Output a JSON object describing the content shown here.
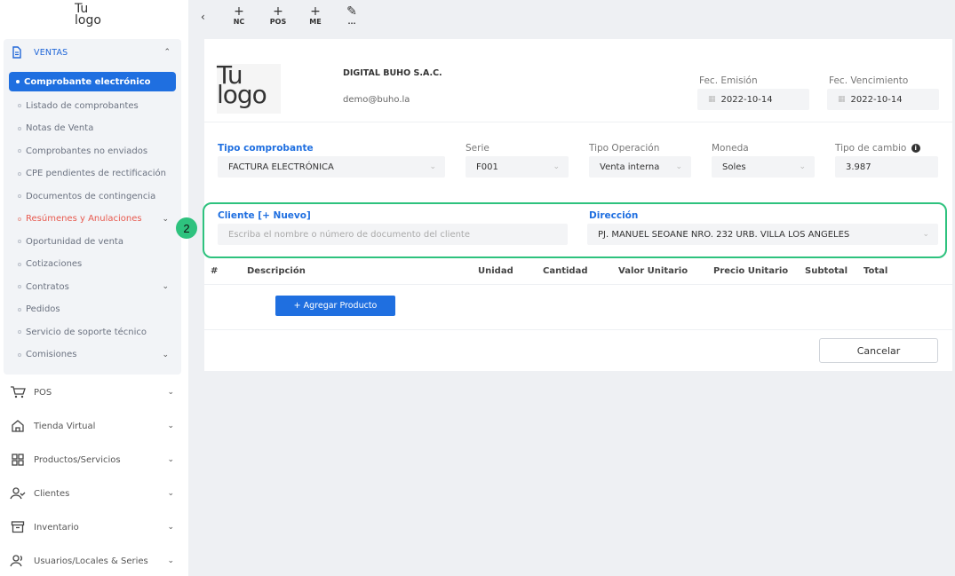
{
  "sidebar": {
    "logo": {
      "line1": "Tu",
      "line2": "logo"
    },
    "ventas": {
      "label": "VENTAS",
      "items": [
        {
          "label": "Comprobante electrónico",
          "active": true
        },
        {
          "label": "Listado de comprobantes"
        },
        {
          "label": "Notas de Venta"
        },
        {
          "label": "Comprobantes no enviados"
        },
        {
          "label": "CPE pendientes de rectificación"
        },
        {
          "label": "Documentos de contingencia"
        },
        {
          "label": "Resúmenes y Anulaciones",
          "highlight": true,
          "expandable": true
        },
        {
          "label": "Oportunidad de venta"
        },
        {
          "label": "Cotizaciones"
        },
        {
          "label": "Contratos",
          "expandable": true
        },
        {
          "label": "Pedidos"
        },
        {
          "label": "Servicio de soporte técnico"
        },
        {
          "label": "Comisiones",
          "expandable": true
        }
      ]
    },
    "nav": [
      {
        "label": "POS",
        "icon": "cart-icon"
      },
      {
        "label": "Tienda Virtual",
        "icon": "home-icon"
      },
      {
        "label": "Productos/Servicios",
        "icon": "grid-icon"
      },
      {
        "label": "Clientes",
        "icon": "user-check-icon"
      },
      {
        "label": "Inventario",
        "icon": "archive-icon"
      },
      {
        "label": "Usuarios/Locales & Series",
        "icon": "users-icon"
      }
    ]
  },
  "step_badge": "2",
  "toolbar": {
    "back": "‹",
    "buttons": [
      {
        "icon": "+",
        "label": "NC"
      },
      {
        "icon": "+",
        "label": "POS"
      },
      {
        "icon": "+",
        "label": "ME"
      },
      {
        "icon": "✎",
        "label": "..."
      }
    ]
  },
  "header": {
    "logo": {
      "line1": "Tu",
      "line2": "logo"
    },
    "company": "DIGITAL BUHO S.A.C.",
    "email": "demo@buho.la",
    "fec_emision_label": "Fec. Emisión",
    "fec_emision": "2022-10-14",
    "fec_vencimiento_label": "Fec. Vencimiento",
    "fec_vencimiento": "2022-10-14"
  },
  "form": {
    "tipo_comprobante_label": "Tipo comprobante",
    "tipo_comprobante": "FACTURA ELECTRÓNICA",
    "serie_label": "Serie",
    "serie": "F001",
    "tipo_operacion_label": "Tipo Operación",
    "tipo_operacion": "Venta interna",
    "moneda_label": "Moneda",
    "moneda": "Soles",
    "tipo_cambio_label": "Tipo de cambio",
    "tipo_cambio": "3.987",
    "cliente_label": "Cliente [+ Nuevo]",
    "cliente_placeholder": "Escriba el nombre o número de documento del cliente",
    "direccion_label": "Dirección",
    "direccion": "PJ. MANUEL SEOANE NRO. 232 URB. VILLA LOS ANGELES"
  },
  "table": {
    "headers": [
      "#",
      "Descripción",
      "Unidad",
      "Cantidad",
      "Valor Unitario",
      "Precio Unitario",
      "Subtotal",
      "Total"
    ]
  },
  "actions": {
    "add_product": "+ Agregar Producto",
    "cancel": "Cancelar"
  },
  "colors": {
    "primary": "#1f6fe0",
    "highlight_green": "#2ec27e",
    "danger_text": "#e85a4f"
  }
}
